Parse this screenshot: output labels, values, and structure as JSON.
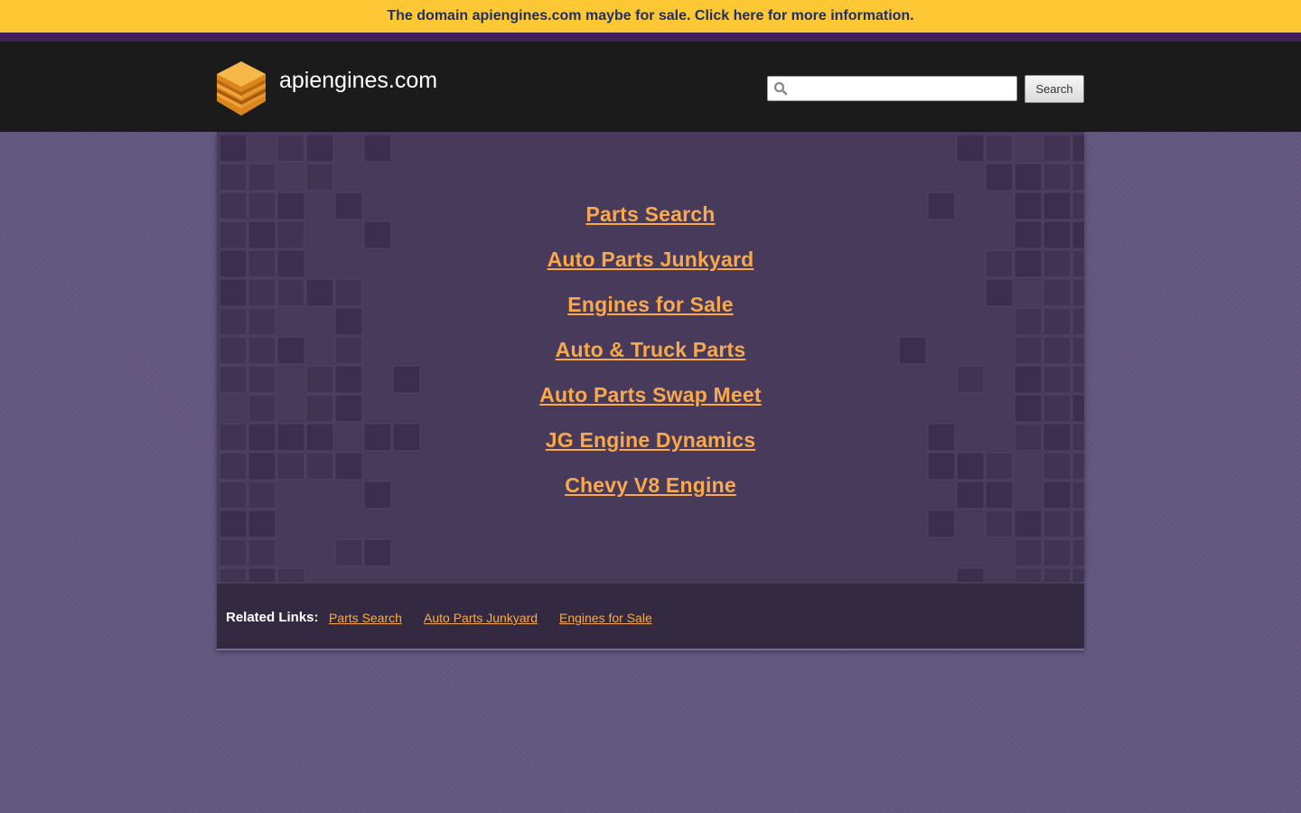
{
  "banner": {
    "text": "The domain apiengines.com maybe for sale. Click here for more information."
  },
  "header": {
    "site_name": "apiengines.com",
    "logo_icon": "layered-cube-logo-icon",
    "search": {
      "placeholder": "",
      "value": "",
      "button_label": "Search",
      "icon": "search-icon"
    }
  },
  "main": {
    "links": [
      "Parts Search",
      "Auto Parts Junkyard",
      "Engines for Sale",
      "Auto & Truck Parts",
      "Auto Parts Swap Meet",
      "JG Engine Dynamics",
      "Chevy V8 Engine"
    ]
  },
  "related": {
    "label": "Related Links:",
    "links": [
      "Parts Search",
      "Auto Parts Junkyard",
      "Engines for Sale"
    ]
  },
  "colors": {
    "banner_bg": "#fdc833",
    "banner_text": "#222f63",
    "header_bg": "#1b1b1b",
    "page_bg": "#635780",
    "panel_bg": "#473a5b",
    "link": "#f9a94b",
    "related_bg": "#332a42"
  }
}
